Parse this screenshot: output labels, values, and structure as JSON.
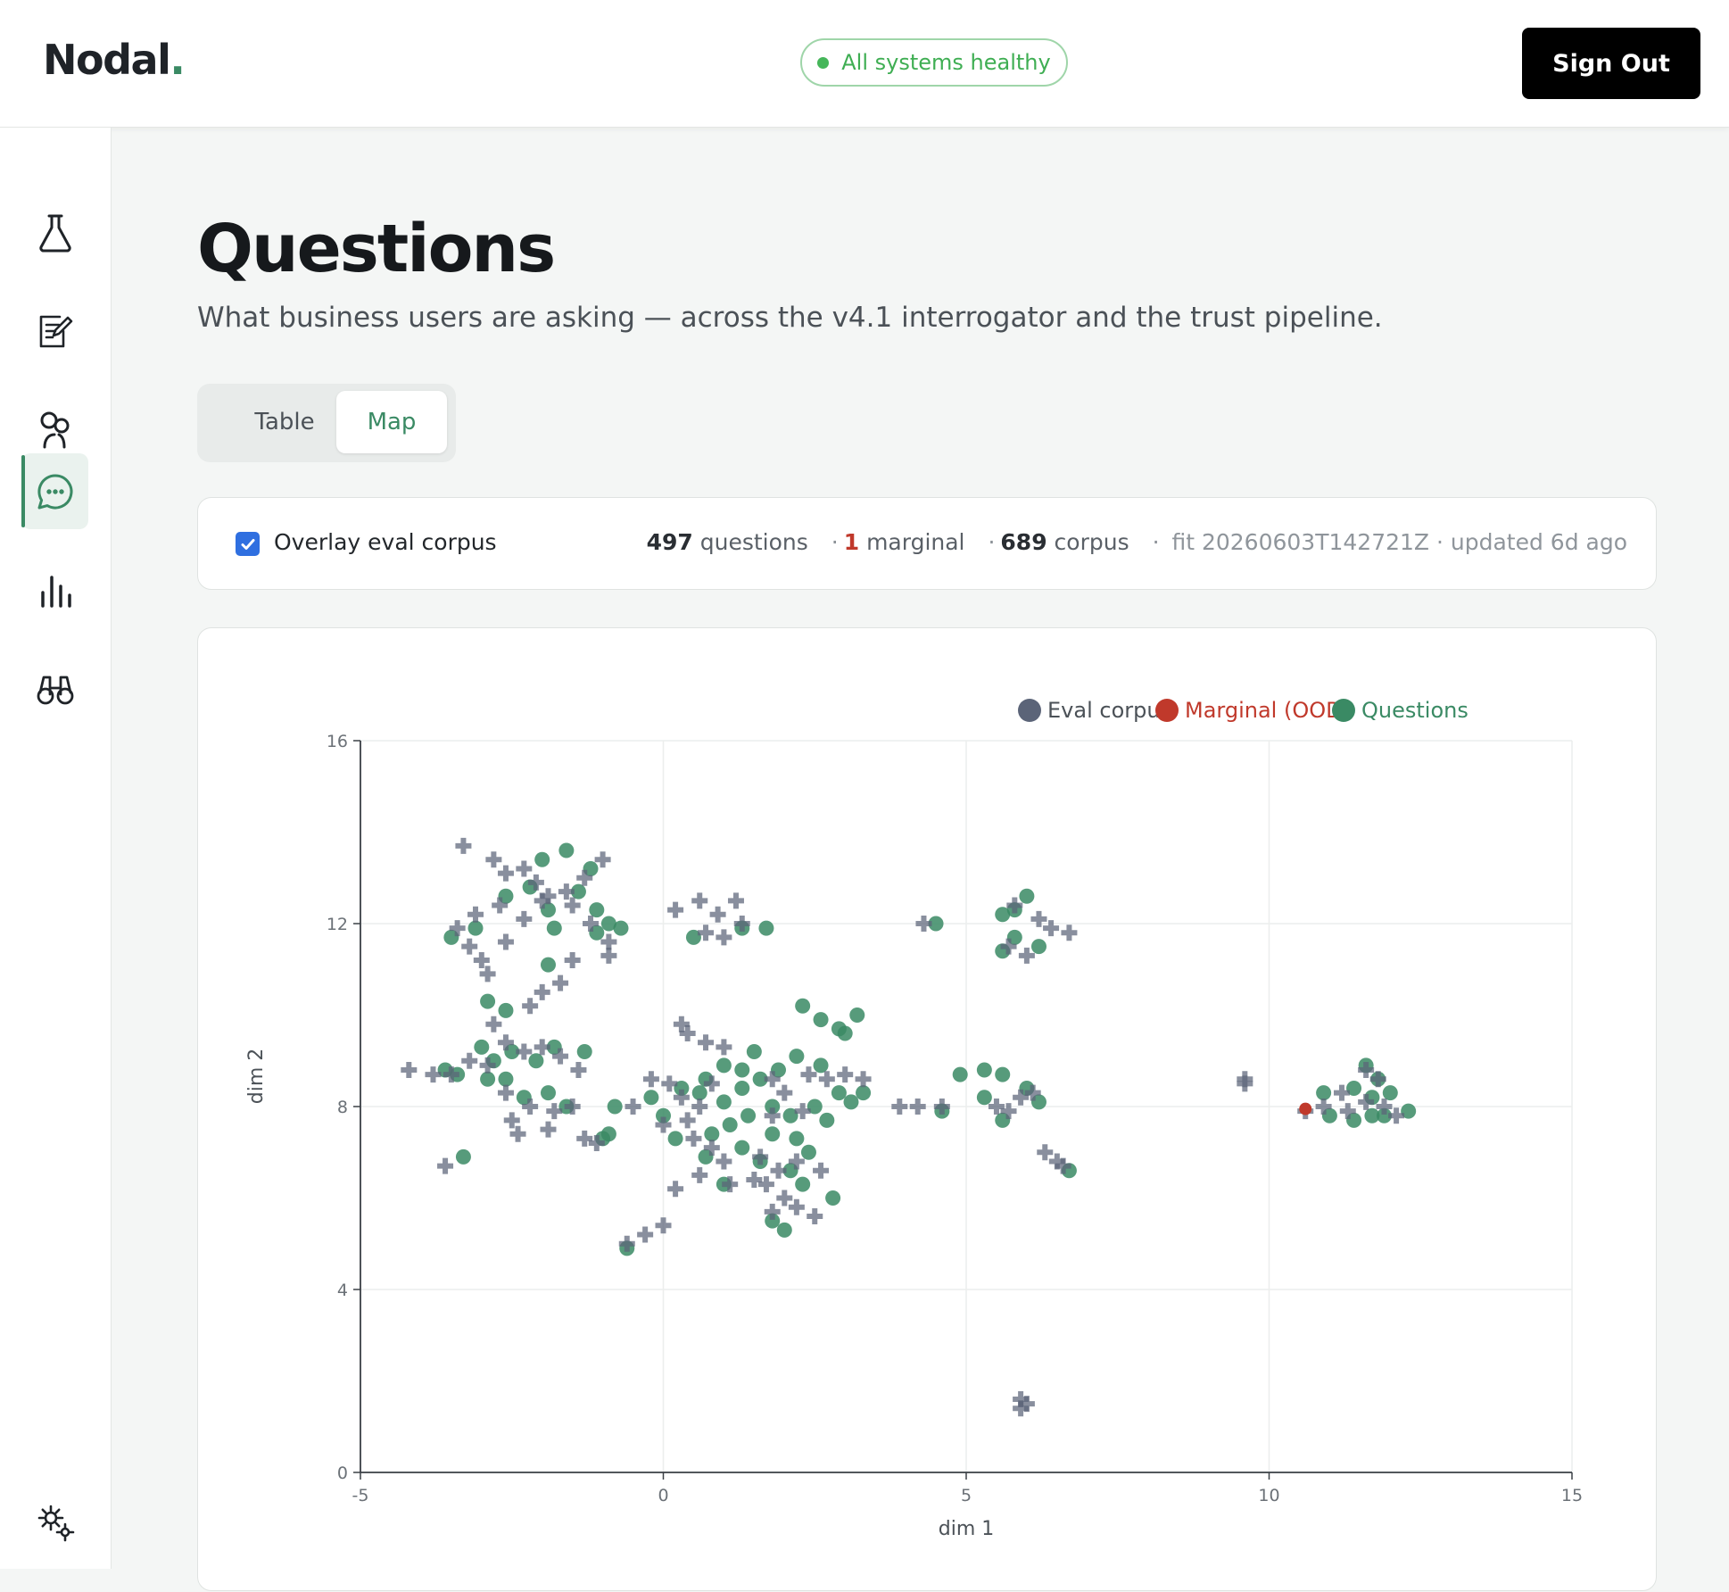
{
  "app": {
    "logo_text": "Nodal",
    "logo_dot": ".",
    "status": "All systems healthy",
    "sign_out": "Sign Out"
  },
  "sidebar": {
    "items": [
      {
        "icon": "flask-icon",
        "active": false
      },
      {
        "icon": "edit-document-icon",
        "active": false
      },
      {
        "icon": "people-icon",
        "active": false
      },
      {
        "icon": "chat-bubble-icon",
        "active": true
      },
      {
        "icon": "bar-chart-icon",
        "active": false
      },
      {
        "icon": "binoculars-icon",
        "active": false
      },
      {
        "icon": "gears-icon",
        "active": false
      }
    ]
  },
  "page": {
    "title": "Questions",
    "subtitle": "What business users are asking — across the v4.1 interrogator and the trust pipeline.",
    "tabs": [
      "Table",
      "Map"
    ],
    "active_tab": "Map"
  },
  "overlay": {
    "checkbox_label": "Overlay eval corpus",
    "checked": true,
    "questions_count": "497",
    "questions_label": "questions",
    "marginal_count": "1",
    "marginal_label": "marginal",
    "corpus_count": "689",
    "corpus_label": "corpus",
    "fit_text": "fit 20260603T142721Z · updated 6d ago"
  },
  "colors": {
    "accent": "#3a8a64",
    "eval_corpus": "#5b6478",
    "marginal": "#c0392b",
    "questions": "#3a8a64",
    "status_green": "#45b65a"
  },
  "chart_data": {
    "type": "scatter",
    "xlabel": "dim 1",
    "ylabel": "dim 2",
    "xlim": [
      -5,
      15
    ],
    "ylim": [
      0,
      16
    ],
    "xticks": [
      -5,
      0,
      5,
      10,
      15
    ],
    "yticks": [
      0,
      4,
      8,
      12,
      16
    ],
    "grid": true,
    "legend_position": "top-right",
    "series": [
      {
        "name": "Eval corpus",
        "marker": "plus",
        "color": "#5b6478",
        "points": [
          [
            -3.3,
            13.7
          ],
          [
            -2.8,
            13.4
          ],
          [
            -2.6,
            13.1
          ],
          [
            -2.3,
            13.2
          ],
          [
            -2.1,
            12.9
          ],
          [
            -1.9,
            12.6
          ],
          [
            -1.6,
            12.7
          ],
          [
            -1.3,
            13.0
          ],
          [
            -1.0,
            13.4
          ],
          [
            -3.1,
            12.2
          ],
          [
            -3.4,
            11.9
          ],
          [
            -3.2,
            11.5
          ],
          [
            -2.7,
            12.4
          ],
          [
            -2.3,
            12.1
          ],
          [
            -1.2,
            12.0
          ],
          [
            -0.9,
            11.6
          ],
          [
            -2.0,
            12.5
          ],
          [
            -1.5,
            12.4
          ],
          [
            -3.0,
            11.2
          ],
          [
            -2.6,
            11.6
          ],
          [
            -2.9,
            10.9
          ],
          [
            -2.0,
            10.5
          ],
          [
            -1.7,
            10.7
          ],
          [
            -1.5,
            11.2
          ],
          [
            -2.2,
            10.2
          ],
          [
            -0.9,
            11.3
          ],
          [
            0.2,
            12.3
          ],
          [
            0.6,
            12.5
          ],
          [
            0.9,
            12.2
          ],
          [
            1.2,
            12.5
          ],
          [
            1.3,
            12.0
          ],
          [
            1.0,
            11.7
          ],
          [
            0.7,
            11.8
          ],
          [
            -2.8,
            9.8
          ],
          [
            -2.6,
            9.4
          ],
          [
            -2.3,
            9.2
          ],
          [
            -2.0,
            9.3
          ],
          [
            -1.7,
            9.1
          ],
          [
            -1.4,
            8.8
          ],
          [
            -2.9,
            8.9
          ],
          [
            -3.2,
            9.0
          ],
          [
            -3.8,
            8.7
          ],
          [
            -4.2,
            8.8
          ],
          [
            -3.5,
            8.7
          ],
          [
            -2.6,
            8.3
          ],
          [
            -2.2,
            8.0
          ],
          [
            -1.8,
            7.9
          ],
          [
            -1.5,
            8.0
          ],
          [
            -2.5,
            7.7
          ],
          [
            -2.4,
            7.4
          ],
          [
            -1.9,
            7.5
          ],
          [
            -1.3,
            7.3
          ],
          [
            -1.1,
            7.2
          ],
          [
            -3.6,
            6.7
          ],
          [
            -0.2,
            8.6
          ],
          [
            0.1,
            8.5
          ],
          [
            0.3,
            8.2
          ],
          [
            0.6,
            8.0
          ],
          [
            0.8,
            8.5
          ],
          [
            0.4,
            7.7
          ],
          [
            0.0,
            7.6
          ],
          [
            0.5,
            7.3
          ],
          [
            0.8,
            7.1
          ],
          [
            1.0,
            6.8
          ],
          [
            0.6,
            6.5
          ],
          [
            0.2,
            6.2
          ],
          [
            0.4,
            9.6
          ],
          [
            0.7,
            9.4
          ],
          [
            1.0,
            9.3
          ],
          [
            0.3,
            9.8
          ],
          [
            1.8,
            8.6
          ],
          [
            2.0,
            8.3
          ],
          [
            2.4,
            8.7
          ],
          [
            2.7,
            8.6
          ],
          [
            3.0,
            8.7
          ],
          [
            3.3,
            8.6
          ],
          [
            2.3,
            7.9
          ],
          [
            1.8,
            7.8
          ],
          [
            1.6,
            6.9
          ],
          [
            1.9,
            6.6
          ],
          [
            2.2,
            6.8
          ],
          [
            2.6,
            6.6
          ],
          [
            1.7,
            6.3
          ],
          [
            2.0,
            6.0
          ],
          [
            1.8,
            5.7
          ],
          [
            2.2,
            5.8
          ],
          [
            2.5,
            5.6
          ],
          [
            1.5,
            6.4
          ],
          [
            1.1,
            6.3
          ],
          [
            -0.6,
            5.0
          ],
          [
            -0.3,
            5.2
          ],
          [
            0.0,
            5.4
          ],
          [
            -0.5,
            8.0
          ],
          [
            3.9,
            8.0
          ],
          [
            4.2,
            8.0
          ],
          [
            4.6,
            8.0
          ],
          [
            5.5,
            8.0
          ],
          [
            5.9,
            8.2
          ],
          [
            6.1,
            8.3
          ],
          [
            5.7,
            7.9
          ],
          [
            5.8,
            12.4
          ],
          [
            6.2,
            12.1
          ],
          [
            6.4,
            11.9
          ],
          [
            6.7,
            11.8
          ],
          [
            5.7,
            11.5
          ],
          [
            6.0,
            11.3
          ],
          [
            6.3,
            7.0
          ],
          [
            6.5,
            6.8
          ],
          [
            6.6,
            6.7
          ],
          [
            4.3,
            12.0
          ],
          [
            5.9,
            1.6
          ],
          [
            5.9,
            1.4
          ],
          [
            6.0,
            1.5
          ],
          [
            9.6,
            8.6
          ],
          [
            9.6,
            8.5
          ],
          [
            10.9,
            8.0
          ],
          [
            11.2,
            8.3
          ],
          [
            11.3,
            7.9
          ],
          [
            11.6,
            8.1
          ],
          [
            11.9,
            8.0
          ],
          [
            12.1,
            7.8
          ],
          [
            11.6,
            8.8
          ],
          [
            11.8,
            8.6
          ],
          [
            10.6,
            7.9
          ]
        ]
      },
      {
        "name": "Marginal (OOD)",
        "marker": "circle",
        "color": "#c0392b",
        "points": [
          [
            10.6,
            7.95
          ]
        ]
      },
      {
        "name": "Questions",
        "marker": "circle",
        "color": "#3a8a64",
        "points": [
          [
            -3.5,
            11.7
          ],
          [
            -3.1,
            11.9
          ],
          [
            -2.6,
            12.6
          ],
          [
            -2.2,
            12.8
          ],
          [
            -1.9,
            12.3
          ],
          [
            -1.4,
            12.7
          ],
          [
            -1.2,
            13.2
          ],
          [
            -1.1,
            12.3
          ],
          [
            -0.9,
            12.0
          ],
          [
            -1.6,
            13.6
          ],
          [
            -2.0,
            13.4
          ],
          [
            -1.8,
            11.9
          ],
          [
            -1.1,
            11.8
          ],
          [
            -0.7,
            11.9
          ],
          [
            -2.9,
            10.3
          ],
          [
            -2.6,
            10.1
          ],
          [
            -1.9,
            11.1
          ],
          [
            -3.0,
            9.3
          ],
          [
            -2.8,
            9.0
          ],
          [
            -2.5,
            9.2
          ],
          [
            -2.1,
            9.0
          ],
          [
            -1.8,
            9.3
          ],
          [
            -1.3,
            9.2
          ],
          [
            -3.4,
            8.7
          ],
          [
            -2.9,
            8.6
          ],
          [
            -3.6,
            8.8
          ],
          [
            -2.6,
            8.6
          ],
          [
            -2.3,
            8.2
          ],
          [
            -1.9,
            8.3
          ],
          [
            -1.6,
            8.0
          ],
          [
            -3.3,
            6.9
          ],
          [
            -1.0,
            7.3
          ],
          [
            -0.9,
            7.4
          ],
          [
            0.5,
            11.7
          ],
          [
            1.3,
            11.9
          ],
          [
            1.7,
            11.9
          ],
          [
            0.3,
            8.4
          ],
          [
            0.6,
            8.3
          ],
          [
            1.0,
            8.1
          ],
          [
            1.3,
            8.4
          ],
          [
            1.6,
            8.6
          ],
          [
            1.9,
            8.8
          ],
          [
            2.2,
            9.1
          ],
          [
            1.5,
            9.2
          ],
          [
            2.6,
            8.9
          ],
          [
            2.9,
            8.3
          ],
          [
            3.1,
            8.1
          ],
          [
            2.5,
            8.0
          ],
          [
            2.1,
            7.8
          ],
          [
            1.8,
            8.0
          ],
          [
            1.4,
            7.8
          ],
          [
            1.1,
            7.6
          ],
          [
            0.8,
            7.4
          ],
          [
            1.3,
            7.1
          ],
          [
            1.8,
            7.4
          ],
          [
            2.2,
            7.3
          ],
          [
            2.7,
            7.7
          ],
          [
            2.4,
            7.0
          ],
          [
            2.1,
            6.6
          ],
          [
            1.6,
            6.8
          ],
          [
            1.0,
            6.3
          ],
          [
            0.7,
            6.9
          ],
          [
            0.2,
            7.3
          ],
          [
            0.0,
            7.8
          ],
          [
            0.7,
            8.6
          ],
          [
            1.0,
            8.9
          ],
          [
            1.3,
            8.8
          ],
          [
            2.3,
            6.3
          ],
          [
            1.8,
            5.5
          ],
          [
            2.0,
            5.3
          ],
          [
            2.8,
            6.0
          ],
          [
            -0.6,
            4.9
          ],
          [
            -0.8,
            8.0
          ],
          [
            -0.2,
            8.2
          ],
          [
            2.3,
            10.2
          ],
          [
            2.6,
            9.9
          ],
          [
            2.9,
            9.7
          ],
          [
            3.2,
            10.0
          ],
          [
            3.0,
            9.6
          ],
          [
            3.3,
            8.3
          ],
          [
            4.6,
            7.9
          ],
          [
            4.5,
            12.0
          ],
          [
            4.9,
            8.7
          ],
          [
            5.3,
            8.8
          ],
          [
            5.6,
            8.7
          ],
          [
            6.0,
            8.4
          ],
          [
            6.2,
            8.1
          ],
          [
            5.3,
            8.2
          ],
          [
            5.6,
            7.7
          ],
          [
            5.6,
            12.2
          ],
          [
            5.8,
            12.3
          ],
          [
            6.0,
            12.6
          ],
          [
            5.6,
            11.4
          ],
          [
            5.8,
            11.7
          ],
          [
            6.2,
            11.5
          ],
          [
            6.7,
            6.6
          ],
          [
            10.9,
            8.3
          ],
          [
            11.0,
            7.8
          ],
          [
            11.4,
            8.4
          ],
          [
            11.7,
            8.2
          ],
          [
            12.0,
            8.3
          ],
          [
            12.3,
            7.9
          ],
          [
            11.7,
            7.8
          ],
          [
            11.4,
            7.7
          ],
          [
            11.9,
            7.8
          ],
          [
            11.8,
            8.6
          ],
          [
            11.6,
            8.9
          ]
        ]
      }
    ]
  }
}
